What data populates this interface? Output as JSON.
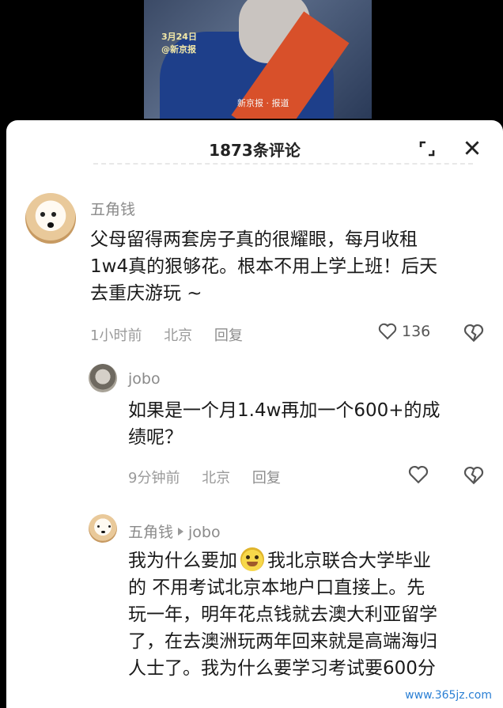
{
  "video": {
    "caption_a": "3月24日",
    "caption_b": "@新京报",
    "caption_c": "新京报 · 报道"
  },
  "sheet": {
    "title": "1873条评论"
  },
  "comments": [
    {
      "username": "五角钱",
      "text_lines": [
        "父母留得两套房子真的很耀眼，每月收租",
        "1w4真的狠够花。根本不用上学上班！后天",
        "去重庆游玩 ~"
      ],
      "time": "1小时前",
      "location": "北京",
      "reply": "回复",
      "likes": "136"
    }
  ],
  "replies": [
    {
      "username": "jobo",
      "text_lines": [
        "如果是一个月1.4w再加一个600+的成",
        "绩呢？"
      ],
      "time": "9分钟前",
      "location": "北京",
      "reply": "回复"
    },
    {
      "username": "五角钱",
      "reply_to": "jobo",
      "text_line_1_a": "我为什么要加",
      "text_line_1_b": "我北京联合大学毕业",
      "text_lines": [
        "的 不用考试北京本地户口直接上。先",
        "玩一年，明年花点钱就去澳大利亚留学",
        "了，在去澳洲玩两年回来就是高端海归",
        "人士了。我为什么要学习考试要600分"
      ]
    }
  ],
  "watermark": "www.365jz.com",
  "icons": {
    "expand": "expand-icon",
    "close": "close-icon",
    "like": "heart-icon",
    "dislike": "broken-heart-icon"
  }
}
